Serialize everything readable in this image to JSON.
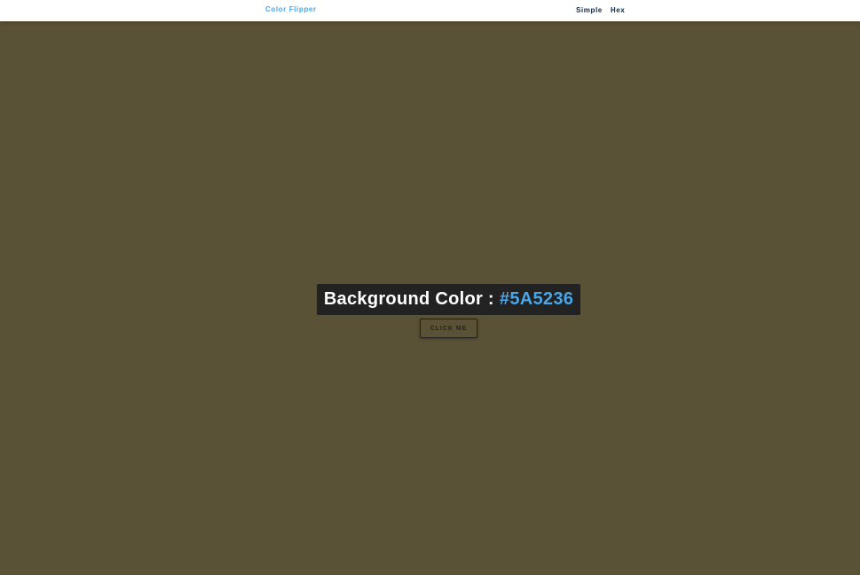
{
  "nav": {
    "brand": "Color Flipper",
    "links": [
      "Simple",
      "Hex"
    ]
  },
  "main": {
    "label": "Background Color :",
    "color_value": "#5A5236",
    "button_label": "CLICK ME"
  },
  "colors": {
    "background": "#5A5236",
    "accent": "#49a6e9",
    "box": "#222222",
    "nav_text": "#102a42"
  }
}
